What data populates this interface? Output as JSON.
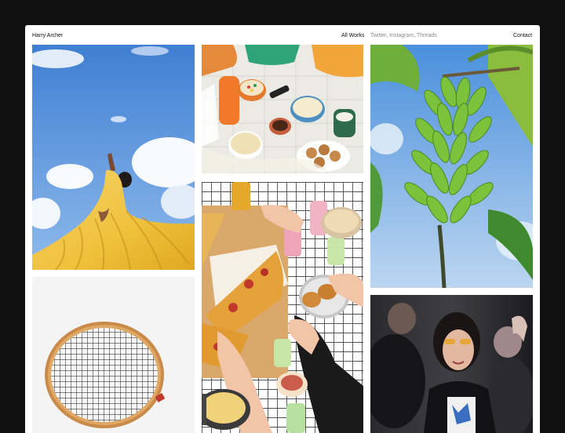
{
  "header": {
    "name": "Harry Archer",
    "all_works": "All Works",
    "social": "Twitter, Instagram, Threads",
    "contact": "Contact"
  },
  "colors": {
    "background": "#111111",
    "page": "#ffffff",
    "text": "#111111",
    "muted_text": "#8a8a8a"
  },
  "gallery": {
    "tiles": [
      {
        "subject": "woman in flowing yellow dress against blue sky"
      },
      {
        "subject": "table with popcorn, cookies and drinks"
      },
      {
        "subject": "green banana bunch on a tree against blue sky"
      },
      {
        "subject": "vintage wooden tennis racket on white"
      },
      {
        "subject": "pizza, fried chicken and soda cans on a grid tablecloth"
      },
      {
        "subject": "woman with orange sunglasses in a crowd"
      }
    ]
  }
}
